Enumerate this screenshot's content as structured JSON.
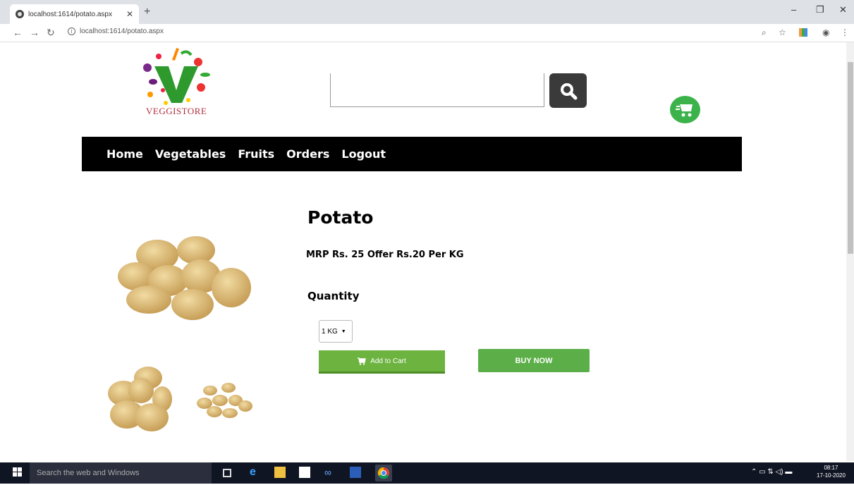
{
  "browser": {
    "tab_title": "localhost:1614/potato.aspx",
    "url": "localhost:1614/potato.aspx"
  },
  "site": {
    "logo_text": "VEGGISTORE",
    "nav": [
      "Home",
      "Vegetables",
      "Fruits",
      "Orders",
      "Logout"
    ]
  },
  "product": {
    "title": "Potato",
    "price_text": "MRP Rs. 25 Offer Rs.20 Per KG",
    "quantity_label": "Quantity",
    "quantity_selected": "1 KG",
    "add_to_cart": "Add to Cart",
    "buy_now": "BUY NOW"
  },
  "taskbar": {
    "search_placeholder": "Search the web and Windows",
    "time": "08:17",
    "date": "17-10-2020"
  },
  "colors": {
    "nav_bg": "#000000",
    "accent_green": "#5caf48",
    "logo_red": "#b03040"
  }
}
